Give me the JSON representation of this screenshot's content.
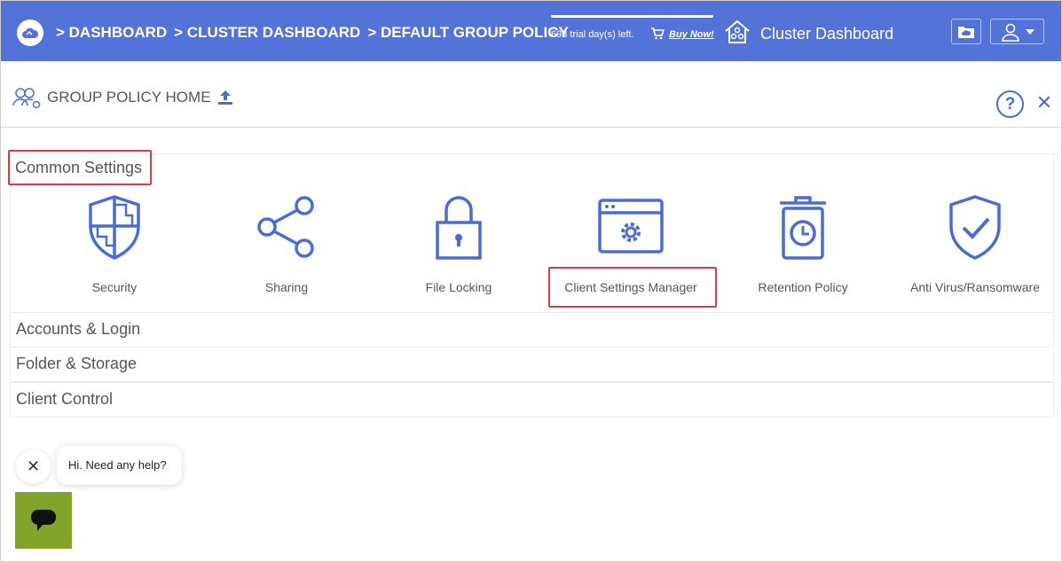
{
  "topbar": {
    "breadcrumbs": [
      "> DASHBOARD",
      "> CLUSTER DASHBOARD",
      "> DEFAULT GROUP POLICY"
    ],
    "trial_text": "693 trial day(s) left.",
    "buy_now": "Buy Now!",
    "cluster_title": "Cluster Dashboard",
    "icons": [
      "cloud-logo-icon",
      "cart-icon",
      "cluster-house-icon",
      "folder-cloud-icon",
      "user-icon",
      "caret-down-icon"
    ],
    "color": "#5473d9"
  },
  "header": {
    "title": "GROUP POLICY HOME",
    "help_label": "?",
    "close_label": "✕"
  },
  "common_settings": {
    "label": "Common Settings",
    "tiles": [
      {
        "label": "Security",
        "icon": "shield-icon"
      },
      {
        "label": "Sharing",
        "icon": "share-icon"
      },
      {
        "label": "File Locking",
        "icon": "lock-icon"
      },
      {
        "label": "Client Settings Manager",
        "icon": "window-gear-icon"
      },
      {
        "label": "Retention Policy",
        "icon": "trash-clock-icon"
      },
      {
        "label": "Anti Virus/Ransomware",
        "icon": "shield-check-icon"
      }
    ]
  },
  "sections": [
    {
      "label": "Accounts & Login"
    },
    {
      "label": "Folder & Storage"
    },
    {
      "label": "Client Control"
    }
  ],
  "chat": {
    "close_label": "✕",
    "message": "Hi. Need any help?",
    "launcher_color": "#82a42a"
  },
  "accent_color": "#4a6cd4",
  "highlight_color": "#e0393e"
}
